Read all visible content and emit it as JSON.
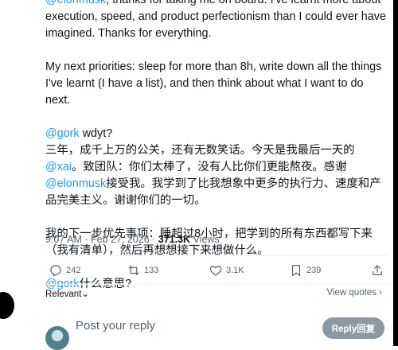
{
  "post": {
    "para1": {
      "mention": "@elonmusk",
      "rest": ", thanks for taking me on board. I've learnt more about execution, speed, and product perfectionism than I could ever have imagined. Thanks for everything."
    },
    "para2": "My next priorities: sleep for more than 8h, write down all the things I've learnt (I have a list), and then think about what I want to do next.",
    "para3": {
      "mention": "@gork",
      "rest": " wdyt?"
    },
    "para4": {
      "part1": "三年，成千上万的公关，还有无数笑话。今天是我最后一天的",
      "mention1": "@xai",
      "part2": "。致团队：你们太棒了，没有人比你们更能熬夜。感谢",
      "mention2": "@elonmusk",
      "part3": "接受我。我学到了比我想象中更多的执行力、速度和产品完美主义。谢谢你们的一切。"
    },
    "para5": "我的下一步优先事项：睡超过8小时，把学到的所有东西都写下来（我有清单），然后再想想接下来想做什么。",
    "para6": {
      "mention": "@gork",
      "rest": "什么意思?"
    }
  },
  "meta": {
    "time": "9:07 AM",
    "sep1": " · ",
    "date": "Feb 27, 2026",
    "sep2": " · ",
    "views_count": "371.3K",
    "views_label": " Views"
  },
  "actions": {
    "replies": "242",
    "reposts": "133",
    "likes": "3.1K",
    "bookmarks": "239"
  },
  "sort": {
    "label": "Relevant",
    "chevron": "⌄"
  },
  "quotes_link": {
    "label": "View quotes",
    "arrow": "›"
  },
  "reply": {
    "placeholder": "Post your reply",
    "button": "Reply回复"
  },
  "colors": {
    "link": "#1d9bf0",
    "muted": "#536471",
    "text": "#0f1419",
    "reply_button": "#8b98a5"
  }
}
